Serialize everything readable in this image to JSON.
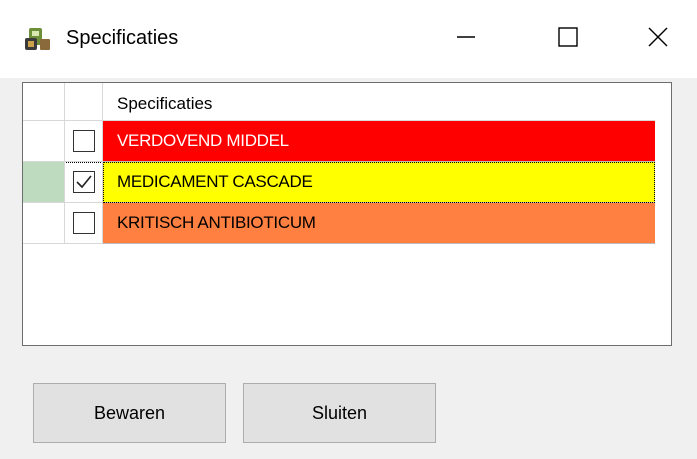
{
  "window": {
    "title": "Specificaties",
    "app_icon": "pharmacy-app-icon",
    "controls": {
      "minimize_icon": "minimize-icon",
      "maximize_icon": "maximize-icon",
      "close_icon": "close-icon"
    }
  },
  "grid": {
    "column_header": "Specificaties",
    "rows": [
      {
        "label": "VERDOVEND MIDDEL",
        "checked": false,
        "bg": "#ff0000",
        "fg": "#ffffff",
        "rowsel_bg": "#ffffff"
      },
      {
        "label": "MEDICAMENT CASCADE",
        "checked": true,
        "bg": "#ffff00",
        "fg": "#000000",
        "rowsel_bg": "#bfdbbf"
      },
      {
        "label": "KRITISCH ANTIBIOTICUM",
        "checked": false,
        "bg": "#ff8040",
        "fg": "#000000",
        "rowsel_bg": "#ffffff"
      }
    ]
  },
  "buttons": {
    "save_label": "Bewaren",
    "close_label": "Sluiten"
  }
}
